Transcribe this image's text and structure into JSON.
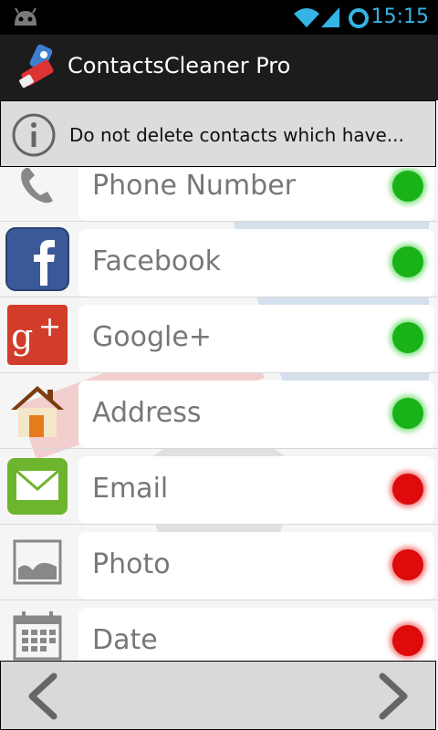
{
  "status_bar": {
    "time": "15:15",
    "icons": [
      "android-icon",
      "wifi-icon",
      "signal-icon",
      "sync-icon"
    ]
  },
  "action_bar": {
    "title": "ContactsCleaner Pro",
    "app_icon": "eraser-icon"
  },
  "info_bar": {
    "text": "Do not delete contacts which have...",
    "icon": "info-icon"
  },
  "criteria": [
    {
      "label": "Phone Number",
      "icon": "phone-icon",
      "status": "green"
    },
    {
      "label": "Facebook",
      "icon": "facebook-icon",
      "status": "green"
    },
    {
      "label": "Google+",
      "icon": "google-plus-icon",
      "status": "green"
    },
    {
      "label": "Address",
      "icon": "house-icon",
      "status": "green"
    },
    {
      "label": "Email",
      "icon": "envelope-icon",
      "status": "red"
    },
    {
      "label": "Photo",
      "icon": "picture-icon",
      "status": "red"
    },
    {
      "label": "Date",
      "icon": "calendar-icon",
      "status": "red"
    }
  ],
  "bottom_bar": {
    "back_icon": "chevron-left-icon",
    "forward_icon": "chevron-right-icon"
  },
  "colors": {
    "green": "#19b319",
    "red": "#dd0b0b",
    "accent": "#33b5e5"
  }
}
